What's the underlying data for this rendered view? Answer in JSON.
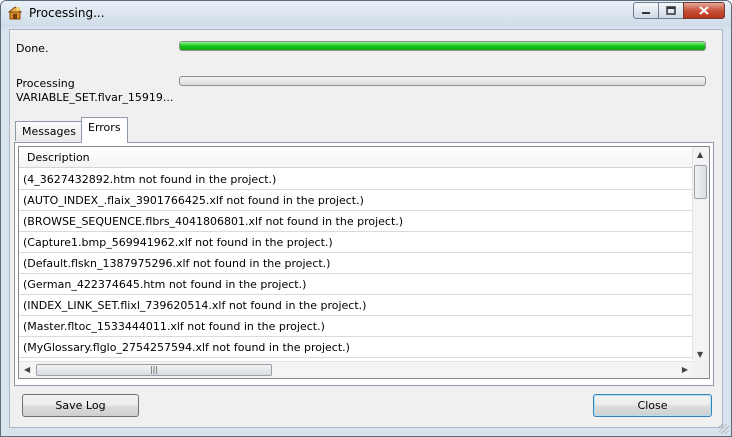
{
  "window": {
    "title": "Processing..."
  },
  "status": {
    "overall_label": "Done.",
    "overall_progress_percent": 100,
    "current_label": "Processing",
    "current_item": "VARIABLE_SET.flvar_15919...",
    "current_progress_percent": 0
  },
  "tabs": [
    {
      "label": "Messages",
      "selected": false
    },
    {
      "label": "Errors",
      "selected": true
    }
  ],
  "errors": {
    "column_header": "Description",
    "rows": [
      "(4_3627432892.htm not found in the project.)",
      "(AUTO_INDEX_.flaix_3901766425.xlf not found in the project.)",
      "(BROWSE_SEQUENCE.flbrs_4041806801.xlf not found in the project.)",
      "(Capture1.bmp_569941962.xlf not found in the project.)",
      "(Default.flskn_1387975296.xlf not found in the project.)",
      "(German_422374645.htm not found in the project.)",
      "(INDEX_LINK_SET.flixl_739620514.xlf not found in the project.)",
      "(Master.fltoc_1533444011.xlf not found in the project.)",
      "(MyGlossary.flglo_2754257594.xlf not found in the project.)"
    ]
  },
  "buttons": {
    "save_log": "Save Log",
    "close": "Close"
  },
  "colors": {
    "progress_fill": "#18c618",
    "close_caption": "#c9513a"
  },
  "icons": {
    "app": "processing-app-icon",
    "minimize": "minimize-icon",
    "maximize": "maximize-icon",
    "close": "close-icon"
  }
}
